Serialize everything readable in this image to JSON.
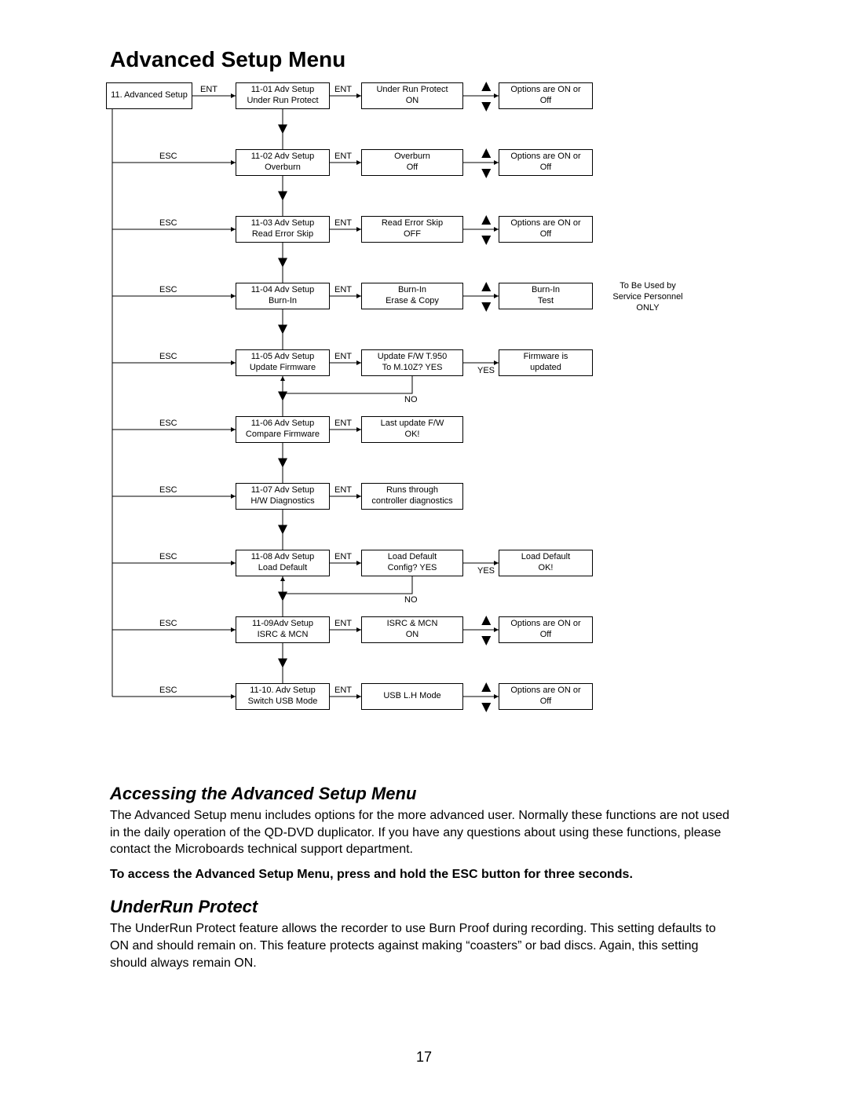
{
  "title": "Advanced Setup Menu",
  "page_number": "17",
  "labels": {
    "ENT": "ENT",
    "ESC": "ESC",
    "YES": "YES",
    "NO": "NO"
  },
  "root": {
    "l1": "11. Advanced Setup",
    "l2": ""
  },
  "rows": [
    {
      "menu": {
        "l1": "11-01 Adv Setup",
        "l2": "Under Run Protect"
      },
      "state": {
        "l1": "Under Run Protect",
        "l2": "ON"
      },
      "opt": {
        "l1": "Options are ON or",
        "l2": "Off"
      },
      "has_opt_arrows": true
    },
    {
      "menu": {
        "l1": "11-02 Adv Setup",
        "l2": "Overburn"
      },
      "state": {
        "l1": "Overburn",
        "l2": "Off"
      },
      "opt": {
        "l1": "Options are ON or",
        "l2": "Off"
      },
      "has_opt_arrows": true
    },
    {
      "menu": {
        "l1": "11-03 Adv Setup",
        "l2": "Read Error Skip"
      },
      "state": {
        "l1": "Read Error Skip",
        "l2": "OFF"
      },
      "opt": {
        "l1": "Options are ON or",
        "l2": "Off"
      },
      "has_opt_arrows": true
    },
    {
      "menu": {
        "l1": "11-04 Adv Setup",
        "l2": "Burn-In"
      },
      "state": {
        "l1": "Burn-In",
        "l2": "Erase & Copy"
      },
      "opt": {
        "l1": "Burn-In",
        "l2": "Test"
      },
      "has_opt_arrows": true,
      "note": {
        "l1": "To Be Used by",
        "l2": "Service Personnel",
        "l3": "ONLY"
      }
    },
    {
      "menu": {
        "l1": "11-05 Adv Setup",
        "l2": "Update Firmware"
      },
      "state": {
        "l1": "Update F/W T.950",
        "l2": "To M.10Z?  YES"
      },
      "opt": {
        "l1": "Firmware is",
        "l2": "updated"
      },
      "yesno": true
    },
    {
      "menu": {
        "l1": "11-06 Adv Setup",
        "l2": "Compare Firmware"
      },
      "state": {
        "l1": "Last update F/W",
        "l2": "OK!"
      }
    },
    {
      "menu": {
        "l1": "11-07 Adv Setup",
        "l2": "H/W Diagnostics"
      },
      "state": {
        "l1": "Runs through",
        "l2": "controller diagnostics"
      }
    },
    {
      "menu": {
        "l1": "11-08 Adv Setup",
        "l2": "Load Default"
      },
      "state": {
        "l1": "Load Default",
        "l2": "Config? YES"
      },
      "opt": {
        "l1": "Load Default",
        "l2": "OK!"
      },
      "yesno": true
    },
    {
      "menu": {
        "l1": "11-09Adv Setup",
        "l2": "ISRC & MCN"
      },
      "state": {
        "l1": "ISRC & MCN",
        "l2": "ON"
      },
      "opt": {
        "l1": "Options are ON or",
        "l2": "Off"
      },
      "has_opt_arrows": true
    },
    {
      "menu": {
        "l1": "11-10. Adv Setup",
        "l2": "Switch USB Mode"
      },
      "state": {
        "l1": "USB L.H Mode",
        "l2": ""
      },
      "opt": {
        "l1": "Options are ON or",
        "l2": "Off"
      },
      "has_opt_arrows": true
    }
  ],
  "sections": {
    "accessing": {
      "heading": "Accessing the Advanced Setup Menu",
      "p1": "The Advanced Setup menu includes options for the more advanced user.  Normally these functions are not used in the daily operation of the QD-DVD duplicator.  If you have any questions about using these functions, please contact the Microboards technical support department.",
      "p2": "To access the Advanced Setup Menu, press and hold the ESC button for three seconds."
    },
    "underrun": {
      "heading": "UnderRun Protect",
      "p1": "The UnderRun Protect feature allows the recorder to use Burn Proof during recording.  This setting defaults to ON and should remain on.  This feature protects against making “coasters” or bad discs.  Again, this setting should always remain ON."
    }
  }
}
